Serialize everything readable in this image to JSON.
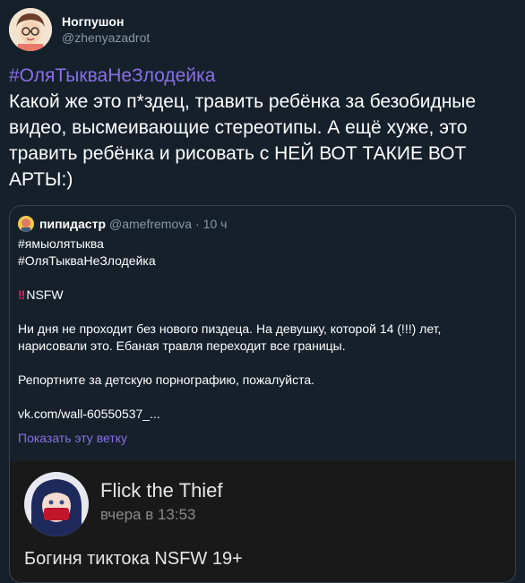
{
  "tweet": {
    "author": {
      "display_name": "Ногпушон",
      "handle": "@zhenyazadrot"
    },
    "hashtag": "#ОляТыкваНеЗлодейка",
    "text": "Какой же это п*здец, травить ребёнка за безобидные видео, высмеивающие стереотипы. А ещё хуже, это травить ребёнка и рисовать с НЕЙ ВОТ ТАКИЕ ВОТ АРТЫ:)"
  },
  "quote": {
    "author_name": "пипидастр",
    "handle": "@amefremova",
    "separator": "·",
    "time": "10 ч",
    "hashtag1": "#ямыолятыква",
    "hashtag2": "#ОляТыкваНеЗлодейка",
    "nsfw_label": "NSFW",
    "paragraph1_line1": "Ни дня не проходит без нового пиздеца. На девушку, которой 14 (!!!) лет,",
    "paragraph1_line2": "нарисовали это. Ебаная травля переходит все границы.",
    "paragraph2": "Репортните за детскую порнографию, пожалуйста.",
    "link": "vk.com/wall-60550537_...",
    "show_thread": "Показать эту ветку"
  },
  "media": {
    "name": "Flick the Thief",
    "time": "вчера в 13:53",
    "caption": "Богиня тиктока NSFW 19+"
  },
  "colors": {
    "background": "#15202b",
    "accent": "#8a6fe8",
    "secondary_text": "#8899a6",
    "border": "#38444d",
    "nsfw_red": "#e0245e",
    "media_bg": "#191919"
  }
}
